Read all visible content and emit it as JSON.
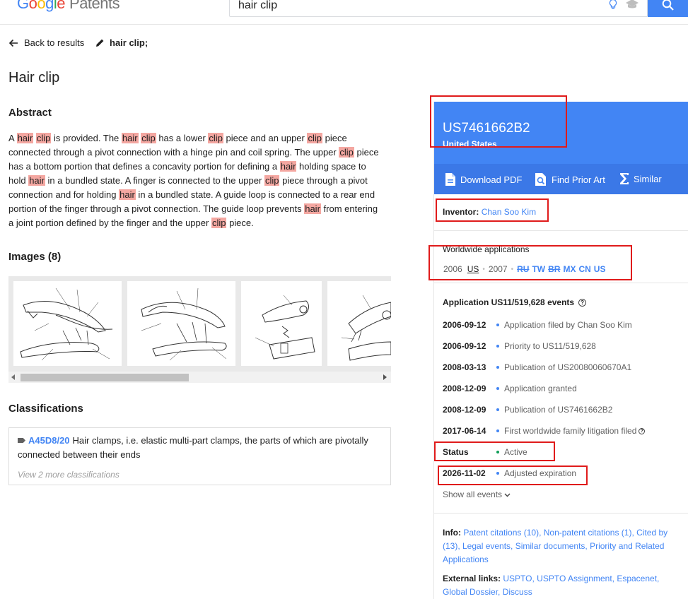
{
  "header": {
    "logo_google": [
      "G",
      "o",
      "o",
      "g",
      "l",
      "e"
    ],
    "logo_product": "Patents",
    "search_value": "hair clip"
  },
  "nav": {
    "back_label": "Back to results",
    "query_label": "hair clip;"
  },
  "patent": {
    "title": "Hair clip",
    "abstract_heading": "Abstract",
    "abstract_segments": [
      {
        "t": "A ",
        "h": false
      },
      {
        "t": "hair",
        "h": true
      },
      {
        "t": " ",
        "h": false
      },
      {
        "t": "clip",
        "h": true
      },
      {
        "t": " is provided. The ",
        "h": false
      },
      {
        "t": "hair",
        "h": true
      },
      {
        "t": " ",
        "h": false
      },
      {
        "t": "clip",
        "h": true
      },
      {
        "t": " has a lower ",
        "h": false
      },
      {
        "t": "clip",
        "h": true
      },
      {
        "t": " piece and an upper ",
        "h": false
      },
      {
        "t": "clip",
        "h": true
      },
      {
        "t": " piece connected through a pivot connection with a hinge pin and coil spring. The upper ",
        "h": false
      },
      {
        "t": "clip",
        "h": true
      },
      {
        "t": " piece has a bottom portion that defines a concavity portion for defining a ",
        "h": false
      },
      {
        "t": "hair",
        "h": true
      },
      {
        "t": " holding space to hold ",
        "h": false
      },
      {
        "t": "hair",
        "h": true
      },
      {
        "t": " in a bundled state. A finger is connected to the upper ",
        "h": false
      },
      {
        "t": "clip",
        "h": true
      },
      {
        "t": " piece through a pivot connection and for holding ",
        "h": false
      },
      {
        "t": "hair",
        "h": true
      },
      {
        "t": " in a bundled state. A guide loop is connected to a rear end portion of the finger through a pivot connection. The guide loop prevents ",
        "h": false
      },
      {
        "t": "hair",
        "h": true
      },
      {
        "t": " from entering a joint portion defined by the finger and the upper ",
        "h": false
      },
      {
        "t": "clip",
        "h": true
      },
      {
        "t": " piece.",
        "h": false
      }
    ],
    "images_heading": "Images (8)",
    "classifications_heading": "Classifications",
    "classification": {
      "code": "A45D8/20",
      "text": "Hair clamps, i.e. elastic multi-part clamps, the parts of which are pivotally connected between their ends",
      "more": "View 2 more classifications"
    }
  },
  "card": {
    "number": "US7461662B2",
    "country": "United States",
    "actions": [
      "Download PDF",
      "Find Prior Art",
      "Similar"
    ]
  },
  "inventor": {
    "label": "Inventor:",
    "name": "Chan Soo Kim"
  },
  "worldwide": {
    "title": "Worldwide applications",
    "year1": "2006",
    "sel": "US",
    "year2": "2007",
    "codes": [
      "RU",
      "TW",
      "BR",
      "MX",
      "CN",
      "US"
    ]
  },
  "application": {
    "title": "Application US11/519,628 events",
    "events": [
      {
        "date": "2006-09-12",
        "desc": "Application filed by Chan Soo Kim"
      },
      {
        "date": "2006-09-12",
        "desc": "Priority to US11/519,628"
      },
      {
        "date": "2008-03-13",
        "desc": "Publication of US20080060670A1"
      },
      {
        "date": "2008-12-09",
        "desc": "Application granted"
      },
      {
        "date": "2008-12-09",
        "desc": "Publication of US7461662B2"
      },
      {
        "date": "2017-06-14",
        "desc": "First worldwide family litigation filed"
      }
    ],
    "status_label": "Status",
    "status_value": "Active",
    "expiration_date": "2026-11-02",
    "expiration_desc": "Adjusted expiration",
    "show_all": "Show all events"
  },
  "info": {
    "label": "Info:",
    "links_text": "Patent citations (10), Non-patent citations (1), Cited by (13), Legal events, Similar documents, Priority and Related Applications",
    "external_label": "External links:",
    "external_text": "USPTO, USPTO Assignment, Espacenet, Global Dossier, Discuss"
  },
  "colors": {
    "brand_blue": "#4285f4",
    "highlight": "#f4a7a1",
    "annotation_red": "#e01b1b"
  }
}
